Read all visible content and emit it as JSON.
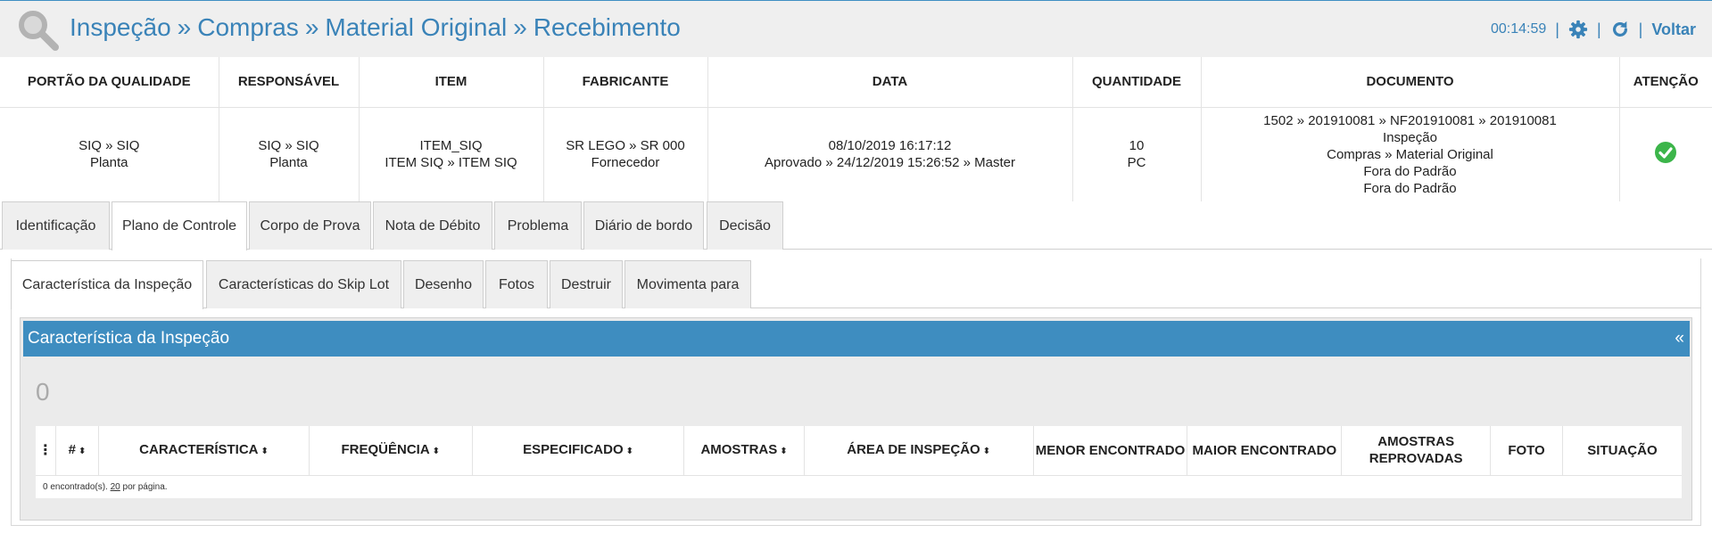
{
  "header": {
    "breadcrumb": [
      "Inspeção",
      "Compras",
      "Material Original",
      "Recebimento"
    ],
    "separator": "»",
    "timer": "00:14:59",
    "back_label": "Voltar",
    "icons": [
      "search-icon",
      "gear-icon",
      "refresh-icon"
    ]
  },
  "info": {
    "headers": [
      "PORTÃO DA QUALIDADE",
      "RESPONSÁVEL",
      "ITEM",
      "FABRICANTE",
      "DATA",
      "QUANTIDADE",
      "DOCUMENTO",
      "ATENÇÃO"
    ],
    "cells": [
      [
        "SIQ » SIQ",
        "Planta"
      ],
      [
        "SIQ » SIQ",
        "Planta"
      ],
      [
        "ITEM_SIQ",
        "ITEM SIQ » ITEM SIQ"
      ],
      [
        "SR LEGO » SR 000",
        "Fornecedor"
      ],
      [
        "08/10/2019 16:17:12",
        "Aprovado » 24/12/2019 15:26:52 » Master"
      ],
      [
        "10",
        "PC"
      ],
      [
        "1502 » 201910081 » NF201910081 » 201910081",
        "Inspeção",
        "Compras » Material Original",
        "Fora do Padrão",
        "Fora do Padrão"
      ]
    ],
    "attention_icon": "check-circle-icon",
    "attention_color": "#3cb54a"
  },
  "tabs": [
    "Identificação",
    "Plano de Controle",
    "Corpo de Prova",
    "Nota de Débito",
    "Problema",
    "Diário de bordo",
    "Decisão"
  ],
  "active_tab": "Plano de Controle",
  "subtabs": [
    "Característica da Inspeção",
    "Características do Skip Lot",
    "Desenho",
    "Fotos",
    "Destruir",
    "Movimenta para"
  ],
  "active_subtab": "Característica da Inspeção",
  "section": {
    "title": "Característica da Inspeção",
    "collapse": "«",
    "count": "0"
  },
  "grid": {
    "menu": "⋮",
    "columns": [
      {
        "label": "#",
        "sortable": true
      },
      {
        "label": "CARACTERÍSTICA",
        "sortable": true
      },
      {
        "label": "FREQÜÊNCIA",
        "sortable": true
      },
      {
        "label": "ESPECIFICADO",
        "sortable": true
      },
      {
        "label": "AMOSTRAS",
        "sortable": true
      },
      {
        "label": "ÁREA DE INSPEÇÃO",
        "sortable": true
      },
      {
        "label": "MENOR ENCONTRADO",
        "sortable": false
      },
      {
        "label": "MAIOR ENCONTRADO",
        "sortable": false
      },
      {
        "label": "AMOSTRAS REPROVADAS",
        "sortable": false
      },
      {
        "label": "FOTO",
        "sortable": false
      },
      {
        "label": "SITUAÇÃO",
        "sortable": false
      }
    ],
    "footer_prefix": "0 encontrado(s).",
    "per_page": "20",
    "footer_suffix": "por página."
  },
  "colors": {
    "accent": "#3a83b8",
    "header_bar": "#3e8dc0",
    "tab_bg": "#efefef"
  }
}
